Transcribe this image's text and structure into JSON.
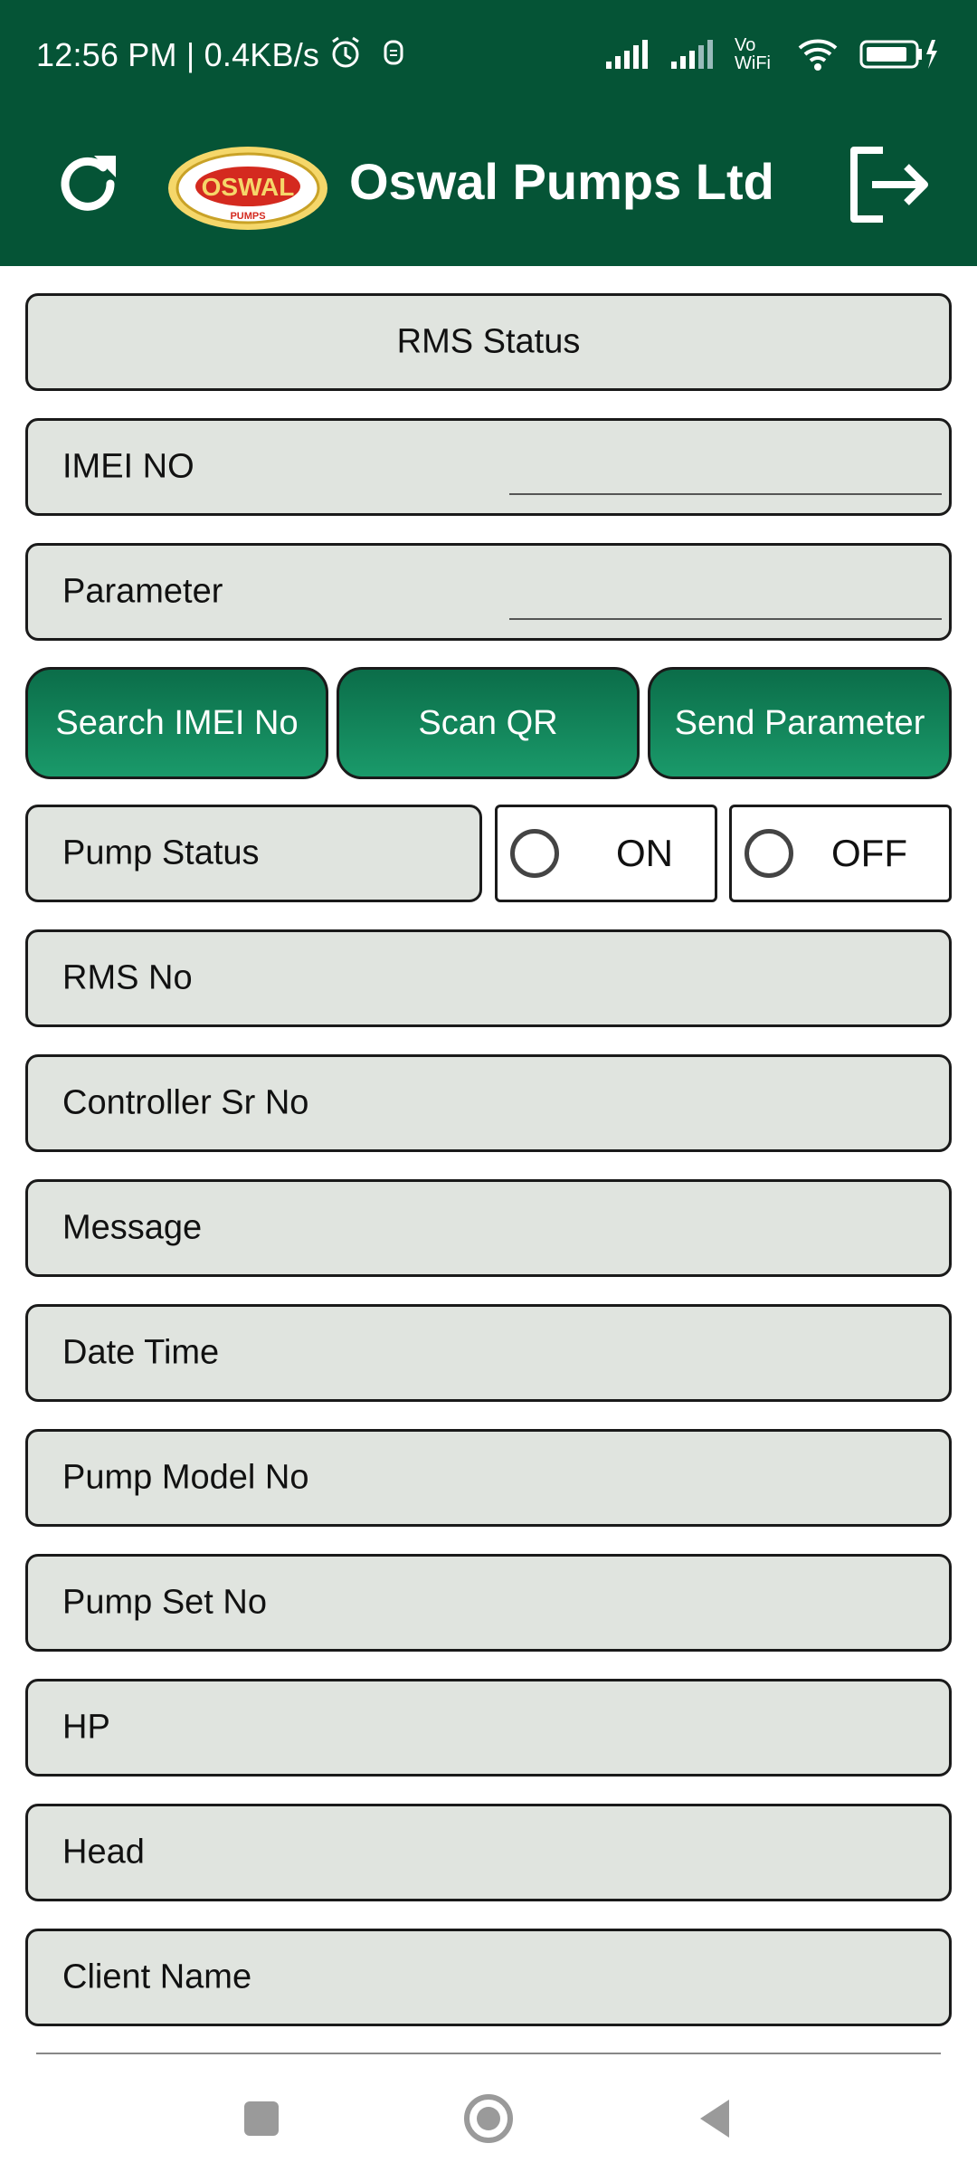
{
  "status_bar": {
    "time_speed": "12:56 PM | 0.4KB/s",
    "alarm_icon": "alarm-icon",
    "notification_icon": "notification-icon",
    "signal_icons": [
      "signal-icon",
      "signal-icon-2"
    ],
    "vowifi": "Vo WiFi",
    "wifi_icon": "wifi-icon",
    "battery_icon": "battery-icon"
  },
  "app_bar": {
    "title": "Oswal Pumps Ltd",
    "logo_text": "OSWAL",
    "logo_subtext": "PUMPS",
    "refresh_icon": "refresh-icon",
    "logout_icon": "logout-icon",
    "bar_color": "#055436"
  },
  "form": {
    "header": "RMS Status",
    "imei_label": "IMEI NO",
    "imei_value": "",
    "parameter_label": "Parameter",
    "parameter_value": "",
    "buttons": {
      "search": "Search IMEI No",
      "scan": "Scan QR",
      "send": "Send Parameter"
    },
    "pump_status": {
      "label": "Pump Status",
      "on": "ON",
      "off": "OFF",
      "selected": "none"
    },
    "fields": [
      "RMS No",
      "Controller Sr No",
      "Message",
      "Date Time",
      "Pump Model No",
      "Pump Set No",
      "HP",
      "Head",
      "Client Name"
    ]
  },
  "nav": {
    "recents": "recents-icon",
    "home": "home-icon",
    "back": "back-icon"
  }
}
